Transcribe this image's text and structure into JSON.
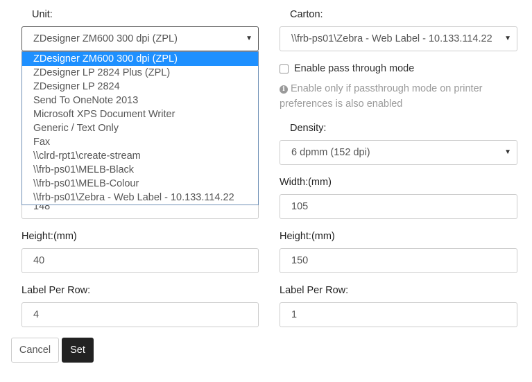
{
  "left": {
    "unit_label": "Unit:",
    "unit_selected": "ZDesigner ZM600 300 dpi (ZPL)",
    "unit_options": [
      "ZDesigner ZM600 300 dpi (ZPL)",
      "ZDesigner LP 2824 Plus (ZPL)",
      "ZDesigner LP 2824",
      "Send To OneNote 2013",
      "Microsoft XPS Document Writer",
      "Generic / Text Only",
      "Fax",
      "\\\\clrd-rpt1\\create-stream",
      "\\\\frb-ps01\\MELB-Black",
      "\\\\frb-ps01\\MELB-Colour",
      "\\\\frb-ps01\\Zebra - Web Label - 10.133.114.22"
    ],
    "width_value": "148",
    "height_label": "Height:(mm)",
    "height_value": "40",
    "per_row_label": "Label Per Row:",
    "per_row_value": "4"
  },
  "right": {
    "carton_label": "Carton:",
    "carton_selected": "\\\\frb-ps01\\Zebra - Web Label - 10.133.114.22",
    "passthrough_label": "Enable pass through mode",
    "passthrough_hint": "Enable only if passthrough mode on printer preferences is also enabled",
    "density_label": "Density:",
    "density_selected": "6 dpmm (152 dpi)",
    "width_label": "Width:(mm)",
    "width_value": "105",
    "height_label": "Height:(mm)",
    "height_value": "150",
    "per_row_label": "Label Per Row:",
    "per_row_value": "1"
  },
  "buttons": {
    "cancel": "Cancel",
    "set": "Set"
  },
  "icons": {
    "caret": "caret-down-icon",
    "info": "info-circle-icon"
  }
}
